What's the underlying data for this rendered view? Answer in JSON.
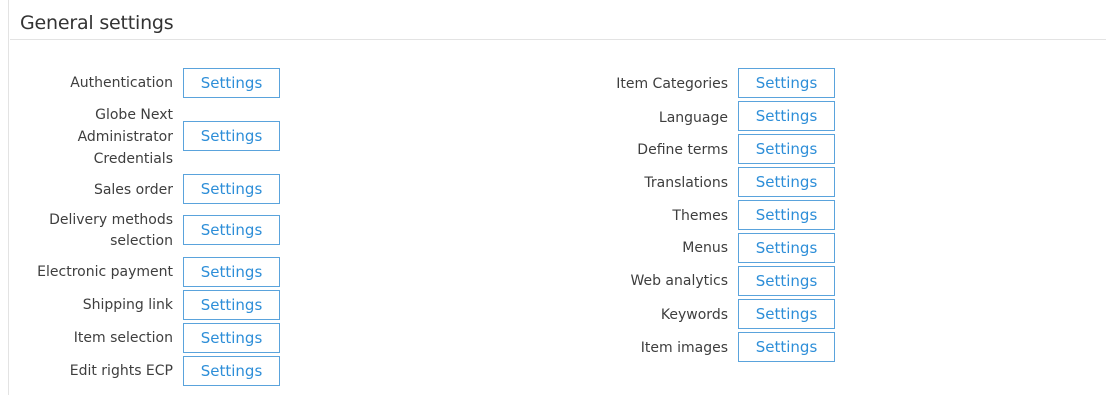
{
  "header": {
    "title": "General settings"
  },
  "left_items": [
    {
      "label": "Authentication",
      "button": "Settings"
    },
    {
      "label": "Globe Next Administrator Credentials",
      "button": "Settings"
    },
    {
      "label": "Sales order",
      "button": "Settings"
    },
    {
      "label": "Delivery methods selection",
      "button": "Settings"
    },
    {
      "label": "Electronic payment",
      "button": "Settings"
    },
    {
      "label": "Shipping link",
      "button": "Settings"
    },
    {
      "label": "Item selection",
      "button": "Settings"
    },
    {
      "label": "Edit rights ECP",
      "button": "Settings"
    }
  ],
  "right_items": [
    {
      "label": "Item Categories",
      "button": "Settings"
    },
    {
      "label": "Language",
      "button": "Settings"
    },
    {
      "label": "Define terms",
      "button": "Settings"
    },
    {
      "label": "Translations",
      "button": "Settings"
    },
    {
      "label": "Themes",
      "button": "Settings"
    },
    {
      "label": "Menus",
      "button": "Settings"
    },
    {
      "label": "Web analytics",
      "button": "Settings"
    },
    {
      "label": "Keywords",
      "button": "Settings"
    },
    {
      "label": "Item images",
      "button": "Settings"
    }
  ],
  "colors": {
    "button_border": "#5aa3dc",
    "button_text": "#2d8ed8",
    "divider": "#e3e3e3"
  }
}
